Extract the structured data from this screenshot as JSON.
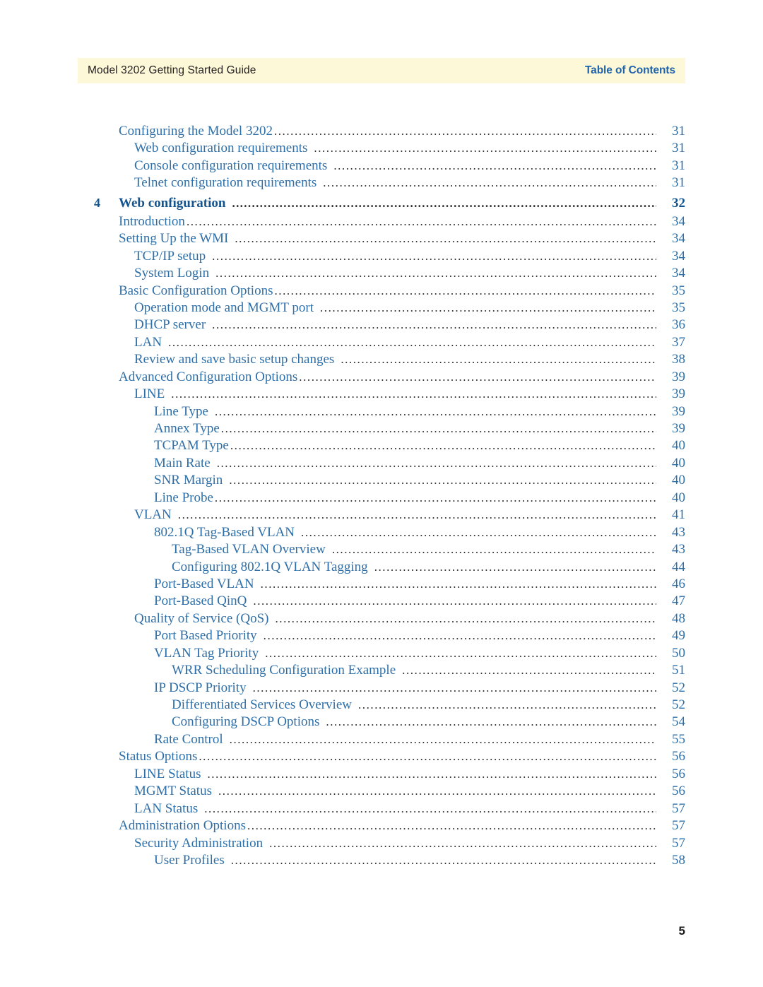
{
  "header": {
    "doc_title": "Model 3202 Getting Started Guide",
    "section_title": "Table of Contents",
    "band_color": "#fdf8d7",
    "section_title_color": "#1f64ab"
  },
  "folio": {
    "page_number": "5"
  },
  "colors": {
    "entry_text": "#2f6fa8",
    "chapter_text": "#15558f",
    "leader_dots": "#2d2d2d",
    "folio": "#1a1a1a"
  },
  "toc": {
    "entries": [
      {
        "num": "",
        "label": "Configuring the Model 3202",
        "page": "31",
        "level": 1,
        "chapter": false,
        "gap": false
      },
      {
        "num": "",
        "label": "Web configuration requirements",
        "page": "31",
        "level": 2,
        "chapter": false,
        "gap": true
      },
      {
        "num": "",
        "label": "Console configuration requirements",
        "page": "31",
        "level": 2,
        "chapter": false,
        "gap": true
      },
      {
        "num": "",
        "label": "Telnet configuration requirements",
        "page": "31",
        "level": 2,
        "chapter": false,
        "gap": true
      },
      {
        "num": "4",
        "label": "Web configuration",
        "page": "32",
        "level": 1,
        "chapter": true,
        "gap": true
      },
      {
        "num": "",
        "label": "Introduction",
        "page": "34",
        "level": 1,
        "chapter": false,
        "gap": false
      },
      {
        "num": "",
        "label": "Setting Up the WMI",
        "page": "34",
        "level": 1,
        "chapter": false,
        "gap": true
      },
      {
        "num": "",
        "label": "TCP/IP setup",
        "page": "34",
        "level": 2,
        "chapter": false,
        "gap": true
      },
      {
        "num": "",
        "label": "System Login",
        "page": "34",
        "level": 2,
        "chapter": false,
        "gap": true
      },
      {
        "num": "",
        "label": "Basic Configuration Options",
        "page": "35",
        "level": 1,
        "chapter": false,
        "gap": false
      },
      {
        "num": "",
        "label": "Operation mode and MGMT port",
        "page": "35",
        "level": 2,
        "chapter": false,
        "gap": true
      },
      {
        "num": "",
        "label": "DHCP server",
        "page": "36",
        "level": 2,
        "chapter": false,
        "gap": true
      },
      {
        "num": "",
        "label": "LAN",
        "page": "37",
        "level": 2,
        "chapter": false,
        "gap": true
      },
      {
        "num": "",
        "label": "Review and save basic setup changes",
        "page": "38",
        "level": 2,
        "chapter": false,
        "gap": true
      },
      {
        "num": "",
        "label": "Advanced Configuration Options",
        "page": "39",
        "level": 1,
        "chapter": false,
        "gap": false
      },
      {
        "num": "",
        "label": "LINE",
        "page": "39",
        "level": 2,
        "chapter": false,
        "gap": true
      },
      {
        "num": "",
        "label": "Line Type",
        "page": "39",
        "level": 3,
        "chapter": false,
        "gap": true
      },
      {
        "num": "",
        "label": "Annex Type",
        "page": "39",
        "level": 3,
        "chapter": false,
        "gap": false
      },
      {
        "num": "",
        "label": "TCPAM Type",
        "page": "40",
        "level": 3,
        "chapter": false,
        "gap": false
      },
      {
        "num": "",
        "label": "Main Rate",
        "page": "40",
        "level": 3,
        "chapter": false,
        "gap": true
      },
      {
        "num": "",
        "label": "SNR Margin",
        "page": "40",
        "level": 3,
        "chapter": false,
        "gap": true
      },
      {
        "num": "",
        "label": "Line Probe",
        "page": "40",
        "level": 3,
        "chapter": false,
        "gap": false
      },
      {
        "num": "",
        "label": "VLAN",
        "page": "41",
        "level": 2,
        "chapter": false,
        "gap": true
      },
      {
        "num": "",
        "label": "802.1Q Tag-Based VLAN",
        "page": "43",
        "level": 3,
        "chapter": false,
        "gap": true
      },
      {
        "num": "",
        "label": "Tag-Based VLAN Overview",
        "page": "43",
        "level": 4,
        "chapter": false,
        "gap": true
      },
      {
        "num": "",
        "label": "Configuring 802.1Q VLAN Tagging",
        "page": "44",
        "level": 4,
        "chapter": false,
        "gap": true
      },
      {
        "num": "",
        "label": "Port-Based VLAN",
        "page": "46",
        "level": 3,
        "chapter": false,
        "gap": true
      },
      {
        "num": "",
        "label": "Port-Based QinQ",
        "page": "47",
        "level": 3,
        "chapter": false,
        "gap": true
      },
      {
        "num": "",
        "label": "Quality of Service (QoS)",
        "page": "48",
        "level": 2,
        "chapter": false,
        "gap": true
      },
      {
        "num": "",
        "label": "Port Based Priority",
        "page": "49",
        "level": 3,
        "chapter": false,
        "gap": true
      },
      {
        "num": "",
        "label": "VLAN Tag Priority",
        "page": "50",
        "level": 3,
        "chapter": false,
        "gap": true
      },
      {
        "num": "",
        "label": "WRR Scheduling Configuration Example",
        "page": "51",
        "level": 4,
        "chapter": false,
        "gap": true
      },
      {
        "num": "",
        "label": "IP DSCP Priority",
        "page": "52",
        "level": 3,
        "chapter": false,
        "gap": true
      },
      {
        "num": "",
        "label": "Differentiated Services Overview",
        "page": "52",
        "level": 4,
        "chapter": false,
        "gap": true
      },
      {
        "num": "",
        "label": "Configuring DSCP Options",
        "page": "54",
        "level": 4,
        "chapter": false,
        "gap": true
      },
      {
        "num": "",
        "label": "Rate Control",
        "page": "55",
        "level": 3,
        "chapter": false,
        "gap": true
      },
      {
        "num": "",
        "label": "Status Options",
        "page": "56",
        "level": 1,
        "chapter": false,
        "gap": false
      },
      {
        "num": "",
        "label": "LINE Status",
        "page": "56",
        "level": 2,
        "chapter": false,
        "gap": true
      },
      {
        "num": "",
        "label": "MGMT Status",
        "page": "56",
        "level": 2,
        "chapter": false,
        "gap": true
      },
      {
        "num": "",
        "label": "LAN Status",
        "page": "57",
        "level": 2,
        "chapter": false,
        "gap": true
      },
      {
        "num": "",
        "label": "Administration Options",
        "page": "57",
        "level": 1,
        "chapter": false,
        "gap": false
      },
      {
        "num": "",
        "label": "Security Administration",
        "page": "57",
        "level": 2,
        "chapter": false,
        "gap": true
      },
      {
        "num": "",
        "label": "User Profiles",
        "page": "58",
        "level": 3,
        "chapter": false,
        "gap": true
      }
    ]
  }
}
